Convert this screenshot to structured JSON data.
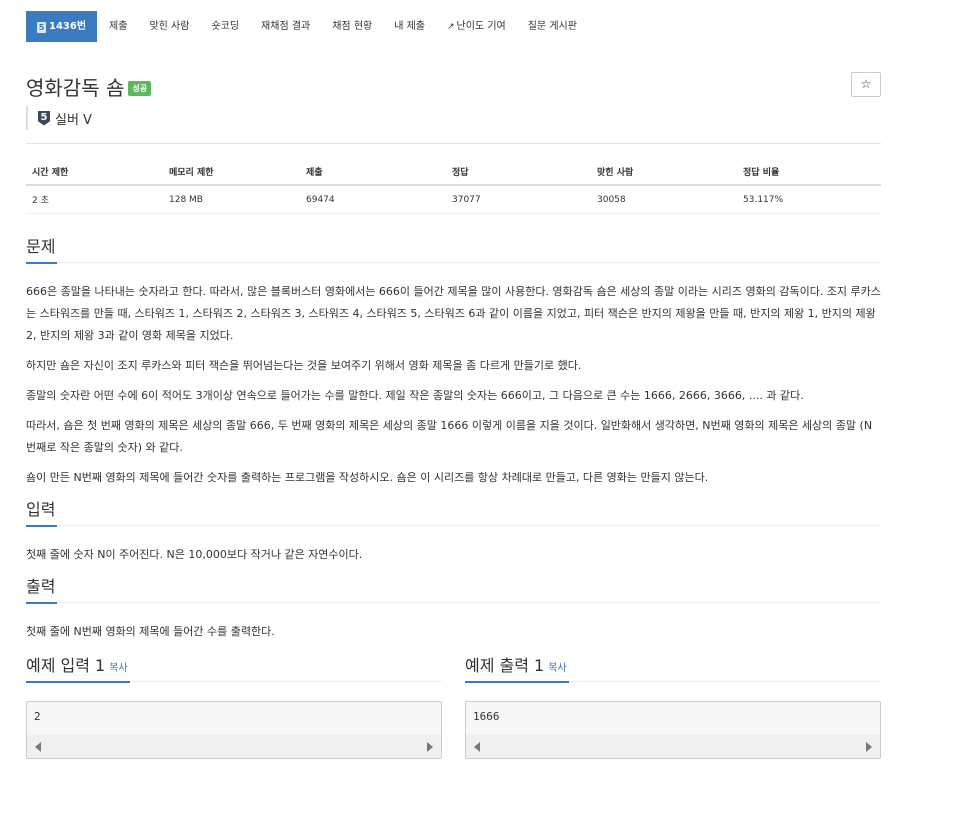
{
  "tabs": [
    {
      "tier_num": "5",
      "label": "1436번",
      "active": true
    },
    {
      "label": "제출"
    },
    {
      "label": "맞힌 사람"
    },
    {
      "label": "숏코딩"
    },
    {
      "label": "재채점 결과"
    },
    {
      "label": "채점 현황"
    },
    {
      "label": "내 제출"
    },
    {
      "label": "난이도 기여",
      "external": true
    },
    {
      "label": "질문 게시판"
    }
  ],
  "problem": {
    "title": "영화감독 숌",
    "result_badge": "성공",
    "star_icon": "☆",
    "tier_num": "5",
    "tier_label": "실버 V"
  },
  "stats": {
    "headers": [
      "시간 제한",
      "메모리 제한",
      "제출",
      "정답",
      "맞힌 사람",
      "정답 비율"
    ],
    "values": [
      "2 초",
      "128 MB",
      "69474",
      "37077",
      "30058",
      "53.117%"
    ]
  },
  "sections": {
    "problem_title": "문제",
    "problem_paragraphs": [
      "666은 종말을 나타내는 숫자라고 한다. 따라서, 많은 블록버스터 영화에서는 666이 들어간 제목을 많이 사용한다. 영화감독 숌은 세상의 종말 이라는 시리즈 영화의 감독이다. 조지 루카스는 스타워즈를 만들 때, 스타워즈 1, 스타워즈 2, 스타워즈 3, 스타워즈 4, 스타워즈 5, 스타워즈 6과 같이 이름을 지었고, 피터 잭슨은 반지의 제왕을 만들 때, 반지의 제왕 1, 반지의 제왕 2, 반지의 제왕 3과 같이 영화 제목을 지었다.",
      "하지만 숌은 자신이 조지 루카스와 피터 잭슨을 뛰어넘는다는 것을 보여주기 위해서 영화 제목을 좀 다르게 만들기로 했다.",
      "종말의 숫자란 어떤 수에 6이 적어도 3개이상 연속으로 들어가는 수를 말한다. 제일 작은 종말의 숫자는 666이고, 그 다음으로 큰 수는 1666, 2666, 3666, .... 과 같다.",
      "따라서, 숌은 첫 번째 영화의 제목은 세상의 종말 666, 두 번째 영화의 제목은 세상의 종말 1666 이렇게 이름을 지을 것이다. 일반화해서 생각하면, N번째 영화의 제목은 세상의 종말 (N번째로 작은 종말의 숫자) 와 같다.",
      "숌이 만든 N번째 영화의 제목에 들어간 숫자를 출력하는 프로그램을 작성하시오. 숌은 이 시리즈를 항상 차례대로 만들고, 다른 영화는 만들지 않는다."
    ],
    "input_title": "입력",
    "input_text": "첫째 줄에 숫자 N이 주어진다. N은 10,000보다 작거나 같은 자연수이다.",
    "output_title": "출력",
    "output_text": "첫째 줄에 N번째 영화의 제목에 들어간 수를 출력한다."
  },
  "samples": {
    "input_title": "예제 입력 1",
    "output_title": "예제 출력 1",
    "copy_label": "복사",
    "input_value": "2",
    "output_value": "1666"
  }
}
